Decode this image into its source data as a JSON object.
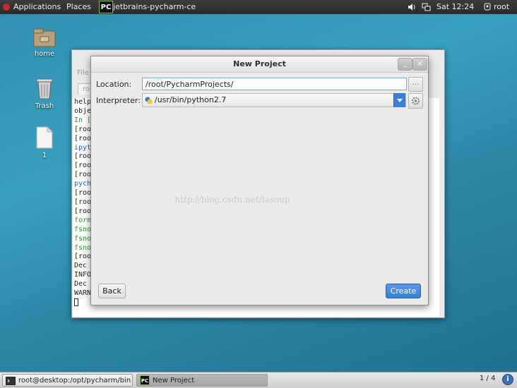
{
  "topbar": {
    "applications": "Applications",
    "places": "Places",
    "active_app": "jetbrains-pycharm-ce",
    "app_icon_text": "PC",
    "clock": "Sat 12:24",
    "user": "root"
  },
  "desktop": {
    "icons": [
      {
        "label": "home"
      },
      {
        "label": "Trash"
      },
      {
        "label": "1"
      }
    ]
  },
  "bg_window": {
    "menu_partial": "File",
    "tab_partial": "ro",
    "terminal_lines": [
      {
        "text": "help",
        "color": "dark"
      },
      {
        "text": "obje",
        "color": "dark"
      },
      {
        "text": "",
        "color": "dark"
      },
      {
        "text": "In [",
        "color": "green"
      },
      {
        "text": "[roo",
        "color": "dark"
      },
      {
        "text": "[roo",
        "color": "dark"
      },
      {
        "text": "ipyt",
        "color": "blue"
      },
      {
        "text": "[roo",
        "color": "dark"
      },
      {
        "text": "[roo",
        "color": "dark"
      },
      {
        "text": "[roo",
        "color": "dark"
      },
      {
        "text": "pych",
        "color": "blue"
      },
      {
        "text": "[roo",
        "color": "dark"
      },
      {
        "text": "[roo",
        "color": "dark"
      },
      {
        "text": "[roo",
        "color": "dark"
      },
      {
        "text": "form",
        "color": "green"
      },
      {
        "text": "fsno",
        "color": "green"
      },
      {
        "text": "fsno",
        "color": "green"
      },
      {
        "text": "fsno",
        "color": "green"
      },
      {
        "text": "[roo",
        "color": "dark"
      },
      {
        "text": "Dec",
        "color": "dark"
      },
      {
        "text": "INFO",
        "color": "dark"
      },
      {
        "text": "Dec",
        "color": "dark"
      },
      {
        "text": "WARN",
        "color": "dark"
      }
    ]
  },
  "dialog": {
    "title": "New Project",
    "minimize": "_",
    "close": "×",
    "location_label": "Location:",
    "location_value": "/root/PycharmProjects/",
    "browse": "...",
    "interpreter_label": "Interpreter:",
    "interpreter_value": "/usr/bin/python2.7",
    "watermark": "http://blog.csdn.net/lasoup",
    "back": "Back",
    "create": "Create"
  },
  "taskbar": {
    "task1": "root@desktop:/opt/pycharm/bin",
    "task2": "New Project",
    "workspace": "1 / 4"
  },
  "colors": {
    "accent": "#3a7fd5",
    "desktop": "#2f8fae"
  }
}
